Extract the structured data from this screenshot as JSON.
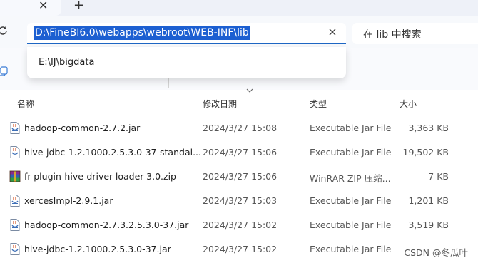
{
  "tabs": {
    "close_symbol": "✕",
    "new_tab_symbol": "+"
  },
  "address_bar": {
    "path": "D:\\FineBI6.0\\webapps\\webroot\\WEB-INF\\lib",
    "suggestion": "E:\\IJ\\bigdata",
    "search_placeholder": "在 lib 中搜索"
  },
  "columns": {
    "name": "名称",
    "modified": "修改日期",
    "type": "类型",
    "size": "大小"
  },
  "files": [
    {
      "name": "hadoop-common-2.7.2.jar",
      "modified": "2024/3/27 15:08",
      "type": "Executable Jar File",
      "size": "3,363 KB",
      "icon": "jar-file-icon"
    },
    {
      "name": "hive-jdbc-1.2.1000.2.5.3.0-37-standal...",
      "modified": "2024/3/27 15:06",
      "type": "Executable Jar File",
      "size": "19,502 KB",
      "icon": "jar-file-icon"
    },
    {
      "name": "fr-plugin-hive-driver-loader-3.0.zip",
      "modified": "2024/3/27 15:06",
      "type": "WinRAR ZIP 压缩...",
      "size": "7 KB",
      "icon": "winrar-zip-icon"
    },
    {
      "name": "xercesImpl-2.9.1.jar",
      "modified": "2024/3/27 15:03",
      "type": "Executable Jar File",
      "size": "1,201 KB",
      "icon": "jar-file-icon"
    },
    {
      "name": "hadoop-common-2.7.3.2.5.3.0-37.jar",
      "modified": "2024/3/27 15:02",
      "type": "Executable Jar File",
      "size": "3,519 KB",
      "icon": "jar-file-icon"
    },
    {
      "name": "hive-jdbc-1.2.1000.2.5.3.0-37.jar",
      "modified": "2024/3/27 15:02",
      "type": "Executable Jar File",
      "size": "",
      "icon": "jar-file-icon"
    }
  ],
  "watermark": "CSDN @冬瓜叶"
}
